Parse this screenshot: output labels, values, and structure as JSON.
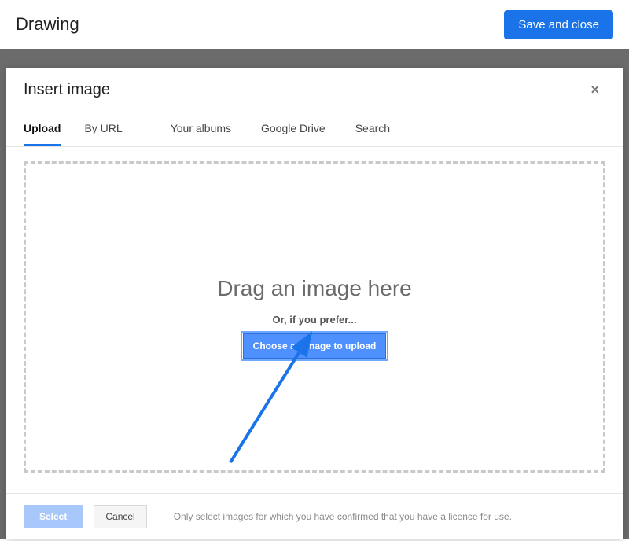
{
  "topbar": {
    "title": "Drawing",
    "save_close": "Save and close"
  },
  "modal": {
    "title": "Insert image",
    "close_glyph": "×",
    "tabs": {
      "upload": "Upload",
      "by_url": "By URL",
      "your_albums": "Your albums",
      "google_drive": "Google Drive",
      "search": "Search"
    },
    "dropzone": {
      "heading": "Drag an image here",
      "sub": "Or, if you prefer...",
      "choose_button": "Choose an image to upload"
    },
    "footer": {
      "select": "Select",
      "cancel": "Cancel",
      "note": "Only select images for which you have confirmed that you have a licence for use."
    }
  },
  "colors": {
    "accent": "#1a73e8",
    "arrow": "#1a73e8"
  }
}
